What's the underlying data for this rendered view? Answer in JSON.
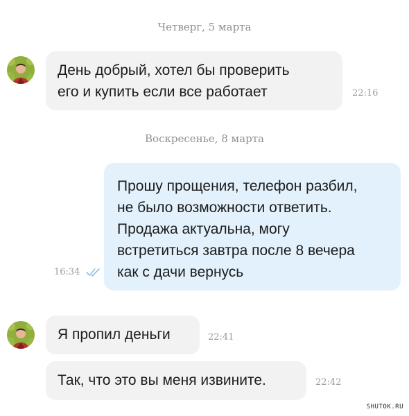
{
  "chat": {
    "date_1": "Четверг, 5 марта",
    "date_2": "Воскресенье, 8 марта",
    "messages": [
      {
        "direction": "incoming",
        "text": "День добрый, хотел бы проверить\nего и купить если все работает",
        "time": "22:16"
      },
      {
        "direction": "outgoing",
        "text": "Прошу прощения, телефон разбил,\nне было возможности ответить.\nПродажа актуальна, могу\nвстретиться завтра после 8 вечера\nкак с дачи вернусь",
        "time": "16:34",
        "status": "read"
      },
      {
        "direction": "incoming",
        "text": "Я пропил деньги",
        "time": "22:41"
      },
      {
        "direction": "incoming",
        "text": "Так, что это вы меня извините.",
        "time": "22:42"
      }
    ]
  },
  "colors": {
    "incoming_bubble": "#f2f2f3",
    "outgoing_bubble": "#e2f1fb",
    "read_check": "#8fc3ec"
  },
  "icons": {
    "avatar": "user-avatar-icon",
    "read_status": "double-check-icon"
  },
  "watermark": "SHUTOK.RU"
}
